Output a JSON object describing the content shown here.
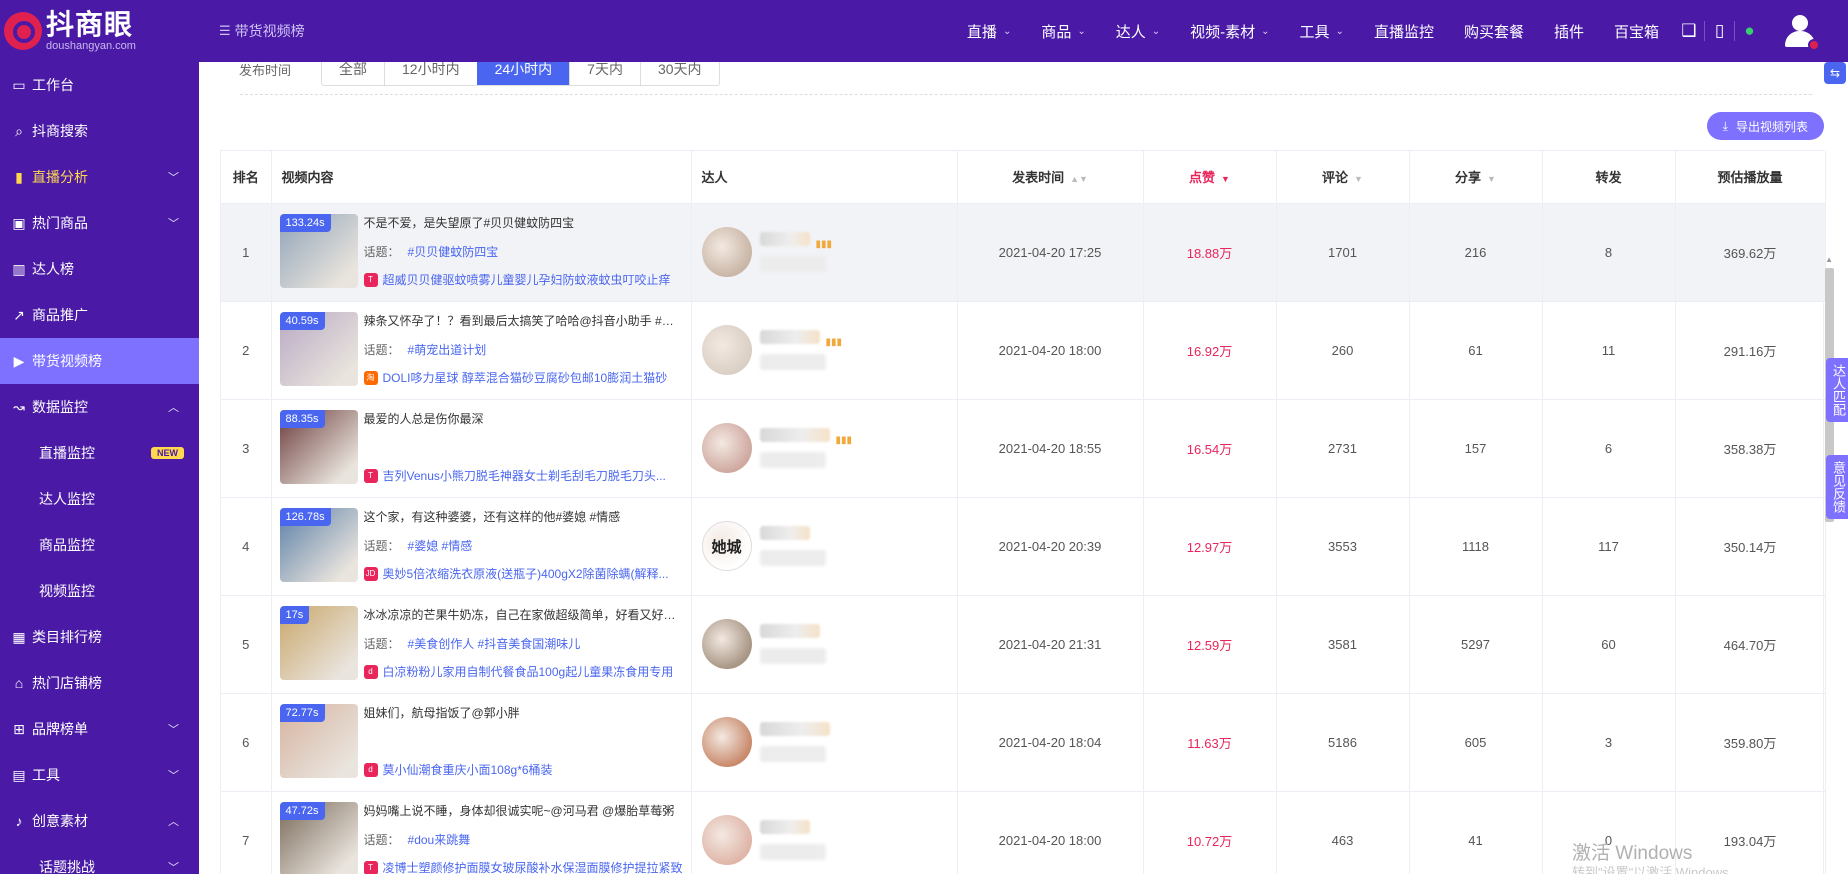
{
  "brand": {
    "name_cn": "抖商眼",
    "domain": "doushangyan.com"
  },
  "breadcrumb": "带货视频榜",
  "topnav": [
    {
      "label": "直播",
      "dropdown": true
    },
    {
      "label": "商品",
      "dropdown": true
    },
    {
      "label": "达人",
      "dropdown": true
    },
    {
      "label": "视频-素材",
      "dropdown": true
    },
    {
      "label": "工具",
      "dropdown": true
    },
    {
      "label": "直播监控",
      "dropdown": false
    },
    {
      "label": "购买套餐",
      "dropdown": false
    },
    {
      "label": "插件",
      "dropdown": false
    },
    {
      "label": "百宝箱",
      "dropdown": false
    }
  ],
  "topicons": [
    "book-icon",
    "phone-icon",
    "wechat-icon"
  ],
  "sidebar": [
    {
      "label": "工作台",
      "icon": "monitor-icon",
      "style": "",
      "arrow": ""
    },
    {
      "label": "抖商搜索",
      "icon": "search-icon",
      "style": "",
      "arrow": ""
    },
    {
      "label": "直播分析",
      "icon": "bar-chart-icon",
      "style": "yellow",
      "arrow": "down"
    },
    {
      "label": "热门商品",
      "icon": "shopping-bag-icon",
      "style": "",
      "arrow": "down"
    },
    {
      "label": "达人榜",
      "icon": "ranking-icon",
      "style": "",
      "arrow": ""
    },
    {
      "label": "商品推广",
      "icon": "share-icon",
      "style": "",
      "arrow": ""
    },
    {
      "label": "带货视频榜",
      "icon": "video-icon",
      "style": "active",
      "arrow": ""
    },
    {
      "label": "数据监控",
      "icon": "trend-icon",
      "style": "",
      "arrow": "up"
    },
    {
      "label": "直播监控",
      "icon": "",
      "style": "sub",
      "arrow": "",
      "badge": "NEW"
    },
    {
      "label": "达人监控",
      "icon": "",
      "style": "sub",
      "arrow": ""
    },
    {
      "label": "商品监控",
      "icon": "",
      "style": "sub",
      "arrow": ""
    },
    {
      "label": "视频监控",
      "icon": "",
      "style": "sub",
      "arrow": ""
    },
    {
      "label": "类目排行榜",
      "icon": "grid-icon",
      "style": "",
      "arrow": ""
    },
    {
      "label": "热门店铺榜",
      "icon": "store-icon",
      "style": "",
      "arrow": ""
    },
    {
      "label": "品牌榜单",
      "icon": "badge-icon",
      "style": "",
      "arrow": "down"
    },
    {
      "label": "工具",
      "icon": "toolbox-icon",
      "style": "",
      "arrow": "down"
    },
    {
      "label": "创意素材",
      "icon": "tiktok-icon",
      "style": "",
      "arrow": "up"
    },
    {
      "label": "话题挑战",
      "icon": "",
      "style": "sub",
      "arrow": "down"
    }
  ],
  "filter": {
    "label": "发布时间",
    "options": [
      "全部",
      "12小时内",
      "24小时内",
      "7天内",
      "30天内"
    ],
    "selected": "24小时内"
  },
  "export_label": "导出视频列表",
  "table": {
    "headers": {
      "rank": "排名",
      "content": "视频内容",
      "talent": "达人",
      "time": "发表时间",
      "likes": "点赞",
      "comments": "评论",
      "shares": "分享",
      "forwards": "转发",
      "plays": "预估播放量"
    },
    "rows": [
      {
        "rank": "1",
        "duration": "133.24s",
        "title": "不是不爱，是失望原了#贝贝健蚊防四宝",
        "topic_label": "话题：",
        "topics": "#贝贝健蚊防四宝",
        "platform": "tm",
        "platform_label": "T",
        "product": "超威贝贝健驱蚊喷雾儿童婴儿孕妇防蚊液蚊虫叮咬止痒",
        "time": "2021-04-20 17:25",
        "likes": "18.88万",
        "comments": "1701",
        "shares": "216",
        "forwards": "8",
        "plays": "369.62万",
        "thumb": "#8fa3b8",
        "avatar": "#c9b6a6",
        "avatar_text": ""
      },
      {
        "rank": "2",
        "duration": "40.59s",
        "title": "辣条又怀孕了！？看到最后太搞笑了哈哈@抖音小助手 #萌宠出道计划",
        "topic_label": "话题：",
        "topics": "#萌宠出道计划",
        "platform": "tb",
        "platform_label": "淘",
        "product": "DOLI哆力星球 醇萃混合猫砂豆腐砂包邮10膨润土猫砂",
        "time": "2021-04-20 18:00",
        "likes": "16.92万",
        "comments": "260",
        "shares": "61",
        "forwards": "11",
        "plays": "291.16万",
        "thumb": "#b8a9c4",
        "avatar": "#d9cfc4",
        "avatar_text": ""
      },
      {
        "rank": "3",
        "duration": "88.35s",
        "title": "最爱的人总是伤你最深",
        "topic_label": "",
        "topics": "",
        "platform": "tm",
        "platform_label": "T",
        "product": "吉列Venus小熊刀脱毛神器女士剃毛刮毛刀脱毛刀头...",
        "time": "2021-04-20 18:55",
        "likes": "16.54万",
        "comments": "2731",
        "shares": "157",
        "forwards": "6",
        "plays": "358.38万",
        "thumb": "#6b3b3b",
        "avatar": "#cfa9a0",
        "avatar_text": ""
      },
      {
        "rank": "4",
        "duration": "126.78s",
        "title": "这个家，有这种婆婆，还有这样的他#婆媳 #情感",
        "topic_label": "话题：",
        "topics": "#婆媳 #情感",
        "platform": "jd",
        "platform_label": "JD",
        "product": "奥妙5倍浓缩洗衣原液(送瓶子)400gX2除菌除螨(解释...",
        "time": "2021-04-20 20:39",
        "likes": "12.97万",
        "comments": "3553",
        "shares": "1118",
        "forwards": "117",
        "plays": "350.14万",
        "thumb": "#5a7fa8",
        "avatar": "#ffffff",
        "avatar_text": "她城"
      },
      {
        "rank": "5",
        "duration": "17s",
        "title": "冰冰凉凉的芒果牛奶冻，自己在家做超级简单，好看又好吃 #美食创作人",
        "topic_label": "话题：",
        "topics": "#美食创作人 #抖音美食国潮味儿",
        "platform": "dy",
        "platform_label": "d",
        "product": "白凉粉粉儿家用自制代餐食品100g起儿童果冻食用专用",
        "time": "2021-04-20 21:31",
        "likes": "12.59万",
        "comments": "3581",
        "shares": "5297",
        "forwards": "60",
        "plays": "464.70万",
        "thumb": "#c9a66a",
        "avatar": "#a89684",
        "avatar_text": ""
      },
      {
        "rank": "6",
        "duration": "72.77s",
        "title": "姐妹们，航母指饭了@郭小胖",
        "topic_label": "",
        "topics": "",
        "platform": "dy",
        "platform_label": "d",
        "product": "莫小仙潮食重庆小面108g*6桶装",
        "time": "2021-04-20 18:04",
        "likes": "11.63万",
        "comments": "5186",
        "shares": "605",
        "forwards": "3",
        "plays": "359.80万",
        "thumb": "#d6b3a0",
        "avatar": "#c98a6c",
        "avatar_text": ""
      },
      {
        "rank": "7",
        "duration": "47.72s",
        "title": "妈妈嘴上说不睡，身体却很诚实呢~@河马君 @爆胎草莓粥",
        "topic_label": "话题：",
        "topics": "#dou来跳舞",
        "platform": "tm",
        "platform_label": "T",
        "product": "凌博士塑颜修护面膜女玻尿酸补水保湿面膜修护提拉紧致",
        "time": "2021-04-20 18:00",
        "likes": "10.72万",
        "comments": "463",
        "shares": "41",
        "forwards": "0",
        "plays": "193.04万",
        "thumb": "#7a6a5a",
        "avatar": "#e0b5a8",
        "avatar_text": ""
      }
    ]
  },
  "side_tabs": {
    "match": "达人匹配",
    "feedback": "意见反馈"
  },
  "watermark": {
    "line1": "激活 Windows",
    "line2": "转到\"设置\"以激活 Windows。"
  }
}
